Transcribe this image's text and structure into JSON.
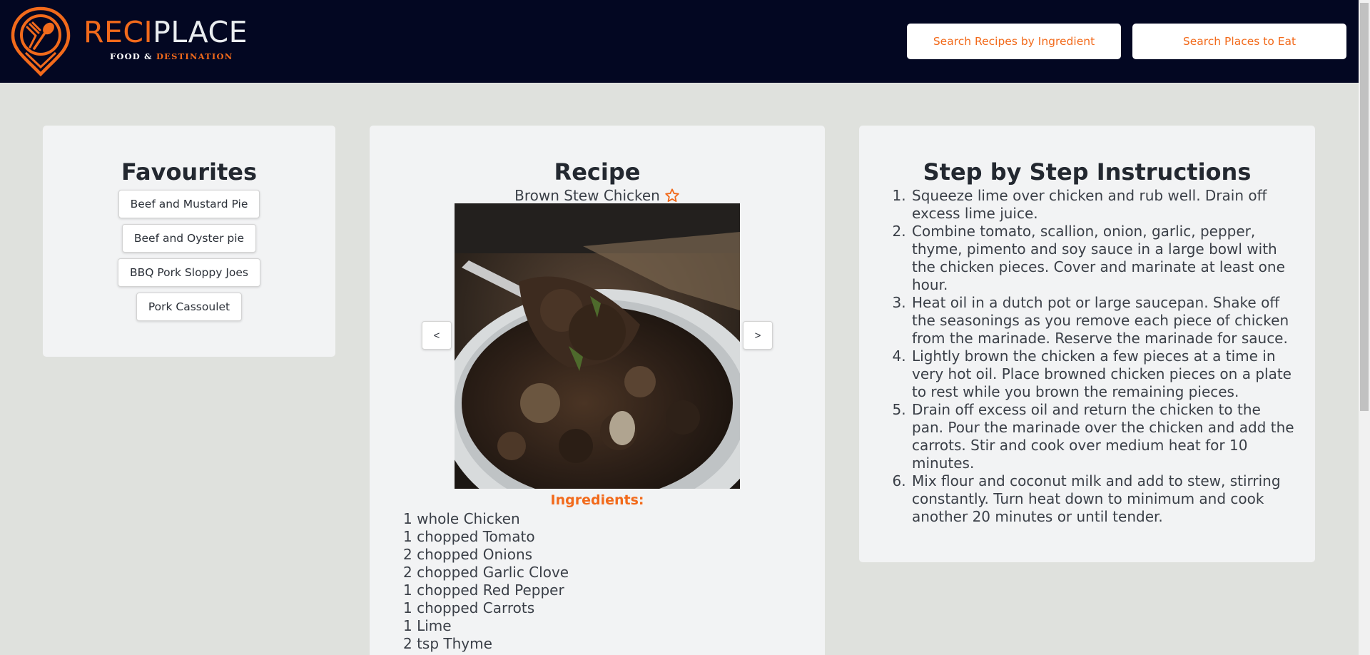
{
  "header": {
    "brand_part1": "RECI",
    "brand_part2": "PLACE",
    "tagline_part1": "FOOD & ",
    "tagline_part2": "DESTINATION",
    "search_recipes_label": "Search Recipes by Ingredient",
    "search_places_label": "Search Places to Eat"
  },
  "favourites": {
    "title": "Favourites",
    "items": [
      "Beef and Mustard Pie",
      "Beef and Oyster pie",
      "BBQ Pork Sloppy Joes",
      "Pork Cassoulet"
    ]
  },
  "recipe": {
    "title": "Recipe",
    "name": "Brown Stew Chicken",
    "prev_label": "<",
    "next_label": ">",
    "ingredients_title": "Ingredients:",
    "ingredients": [
      "1 whole Chicken",
      "1 chopped Tomato",
      "2 chopped Onions",
      "2 chopped Garlic Clove",
      "1 chopped Red Pepper",
      "1 chopped Carrots",
      "1 Lime",
      "2 tsp Thyme"
    ]
  },
  "instructions": {
    "title": "Step by Step Instructions",
    "steps": [
      "Squeeze lime over chicken and rub well. Drain off excess lime juice.",
      "Combine tomato, scallion, onion, garlic, pepper, thyme, pimento and soy sauce in a large bowl with the chicken pieces. Cover and marinate at least one hour.",
      "Heat oil in a dutch pot or large saucepan. Shake off the seasonings as you remove each piece of chicken from the marinade. Reserve the marinade for sauce.",
      "Lightly brown the chicken a few pieces at a time in very hot oil. Place browned chicken pieces on a plate to rest while you brown the remaining pieces.",
      "Drain off excess oil and return the chicken to the pan. Pour the marinade over the chicken and add the carrots. Stir and cook over medium heat for 10 minutes.",
      "Mix flour and coconut milk and add to stew, stirring constantly. Turn heat down to minimum and cook another 20 minutes or until tender."
    ]
  },
  "colors": {
    "header_bg": "#030722",
    "accent": "#f26a1b",
    "page_bg": "#dfe1dd",
    "card_bg": "#f2f3f4"
  },
  "icons": {
    "logo": "pin-with-fork-spoon-icon",
    "favourite": "star-outline-icon"
  }
}
